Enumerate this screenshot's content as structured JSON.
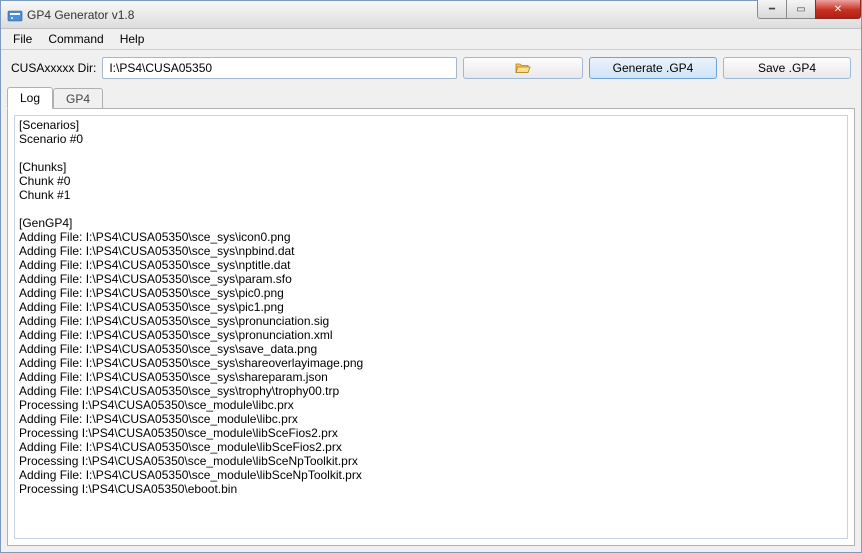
{
  "window": {
    "title": "GP4 Generator v1.8"
  },
  "menu": {
    "file": "File",
    "command": "Command",
    "help": "Help"
  },
  "toolbar": {
    "dir_label": "CUSAxxxxx Dir:",
    "dir_value": "I:\\PS4\\CUSA05350",
    "generate_label": "Generate .GP4",
    "save_label": "Save .GP4"
  },
  "tabs": {
    "log": "Log",
    "gp4": "GP4"
  },
  "log_lines": [
    "[Scenarios]",
    "Scenario #0",
    "",
    "[Chunks]",
    "Chunk #0",
    "Chunk #1",
    "",
    "[GenGP4]",
    "Adding File: I:\\PS4\\CUSA05350\\sce_sys\\icon0.png",
    "Adding File: I:\\PS4\\CUSA05350\\sce_sys\\npbind.dat",
    "Adding File: I:\\PS4\\CUSA05350\\sce_sys\\nptitle.dat",
    "Adding File: I:\\PS4\\CUSA05350\\sce_sys\\param.sfo",
    "Adding File: I:\\PS4\\CUSA05350\\sce_sys\\pic0.png",
    "Adding File: I:\\PS4\\CUSA05350\\sce_sys\\pic1.png",
    "Adding File: I:\\PS4\\CUSA05350\\sce_sys\\pronunciation.sig",
    "Adding File: I:\\PS4\\CUSA05350\\sce_sys\\pronunciation.xml",
    "Adding File: I:\\PS4\\CUSA05350\\sce_sys\\save_data.png",
    "Adding File: I:\\PS4\\CUSA05350\\sce_sys\\shareoverlayimage.png",
    "Adding File: I:\\PS4\\CUSA05350\\sce_sys\\shareparam.json",
    "Adding File: I:\\PS4\\CUSA05350\\sce_sys\\trophy\\trophy00.trp",
    "Processing I:\\PS4\\CUSA05350\\sce_module\\libc.prx",
    "Adding File: I:\\PS4\\CUSA05350\\sce_module\\libc.prx",
    "Processing I:\\PS4\\CUSA05350\\sce_module\\libSceFios2.prx",
    "Adding File: I:\\PS4\\CUSA05350\\sce_module\\libSceFios2.prx",
    "Processing I:\\PS4\\CUSA05350\\sce_module\\libSceNpToolkit.prx",
    "Adding File: I:\\PS4\\CUSA05350\\sce_module\\libSceNpToolkit.prx",
    "Processing I:\\PS4\\CUSA05350\\eboot.bin"
  ]
}
